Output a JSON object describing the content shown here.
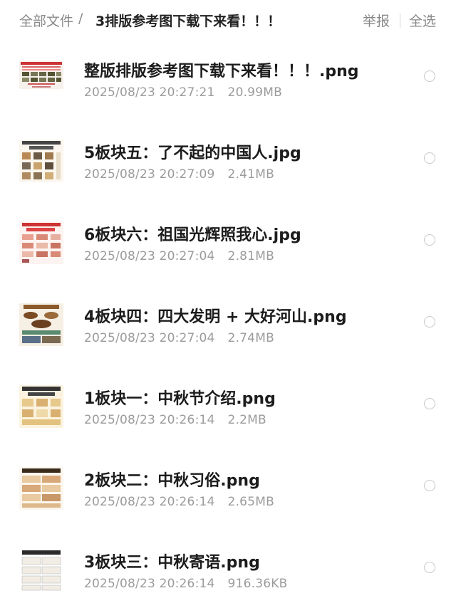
{
  "breadcrumb": {
    "root": "全部文件",
    "separator": "/",
    "current": "3排版参考图下载下来看！！！"
  },
  "actions": {
    "report": "举报",
    "select_all": "全选"
  },
  "files": [
    {
      "name": "整版排版参考图下载下来看！！！.png",
      "date": "2025/08/23 20:27:21",
      "size": "20.99MB",
      "thumb_icon": "collage-thumbnail-icon"
    },
    {
      "name": "5板块五：了不起的中国人.jpg",
      "date": "2025/08/23 20:27:09",
      "size": "2.41MB",
      "thumb_icon": "image-thumbnail-icon"
    },
    {
      "name": "6板块六：祖国光辉照我心.jpg",
      "date": "2025/08/23 20:27:04",
      "size": "2.81MB",
      "thumb_icon": "image-thumbnail-icon"
    },
    {
      "name": "4板块四：四大发明 + 大好河山.png",
      "date": "2025/08/23 20:27:04",
      "size": "2.74MB",
      "thumb_icon": "image-thumbnail-icon"
    },
    {
      "name": "1板块一：中秋节介绍.png",
      "date": "2025/08/23 20:26:14",
      "size": "2.2MB",
      "thumb_icon": "image-thumbnail-icon"
    },
    {
      "name": "2板块二：中秋习俗.png",
      "date": "2025/08/23 20:26:14",
      "size": "2.65MB",
      "thumb_icon": "image-thumbnail-icon"
    },
    {
      "name": "3板块三：中秋寄语.png",
      "date": "2025/08/23 20:26:14",
      "size": "916.36KB",
      "thumb_icon": "image-thumbnail-icon"
    }
  ],
  "colors": {
    "text_primary": "#1c1c1c",
    "text_secondary": "#9b9b9b",
    "radio_border": "#c8c8c8"
  }
}
